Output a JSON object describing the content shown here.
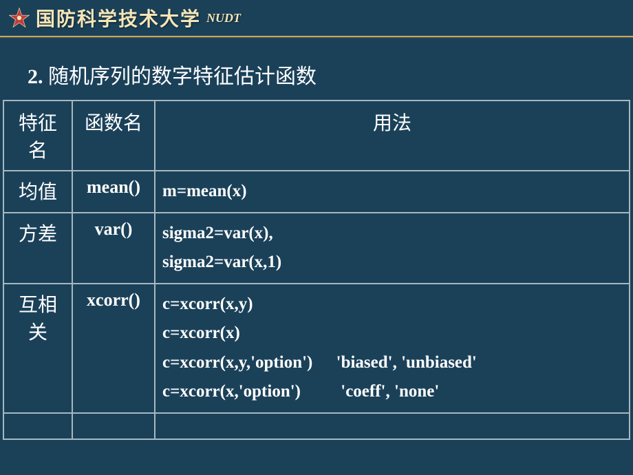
{
  "header": {
    "university_name": "国防科学技术大学",
    "university_abbr": "NUDT"
  },
  "title": {
    "number": "2.",
    "text": "随机序列的数字特征估计函数"
  },
  "table": {
    "headers": {
      "col1": "特征名",
      "col2": "函数名",
      "col3": "用法"
    },
    "rows": [
      {
        "feature": "均值",
        "func": "mean()",
        "usage": [
          "m=mean(x)"
        ]
      },
      {
        "feature": "方差",
        "func": "var()",
        "usage": [
          "sigma2=var(x),",
          "sigma2=var(x,1)"
        ]
      },
      {
        "feature": "互相关",
        "func": "xcorr()",
        "usage": [
          "c=xcorr(x,y)",
          "c=xcorr(x)",
          {
            "main": "c=xcorr(x,y,'option')",
            "note": "'biased', 'unbiased'"
          },
          {
            "main": "c=xcorr(x,'option')",
            "note": "'coeff', 'none'"
          }
        ]
      }
    ]
  }
}
